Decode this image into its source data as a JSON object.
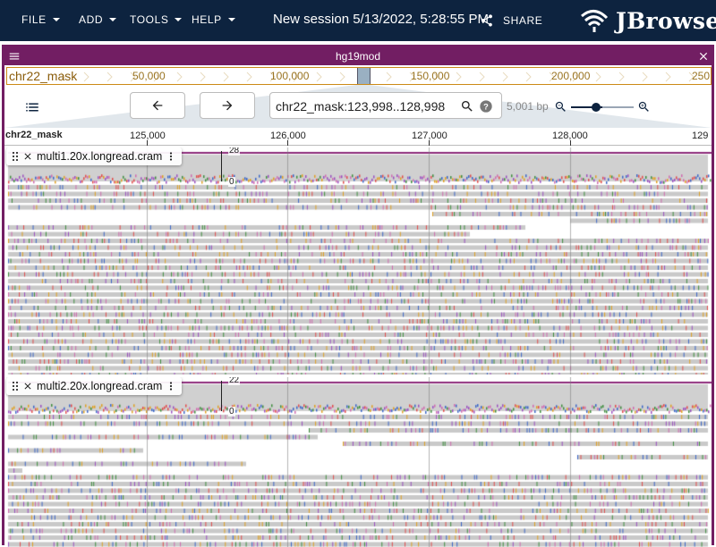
{
  "appbar": {
    "menus": [
      "FILE",
      "ADD",
      "TOOLS",
      "HELP"
    ],
    "session_title": "New session 5/13/2022, 5:28:55 PM",
    "share_label": "SHARE",
    "logo_text": "JBrowse"
  },
  "view": {
    "title": "hg19mod",
    "overview": {
      "ref_name": "chr22_mask",
      "ticks": [
        "50,000",
        "100,000",
        "150,000",
        "200,000",
        "250"
      ]
    },
    "location": "chr22_mask:123,998..128,998",
    "bp_label": "5,001 bp",
    "ruler": {
      "ref_name": "chr22_mask",
      "ticks": [
        "125,000",
        "126,000",
        "127,000",
        "128,000",
        "129"
      ]
    },
    "tracks": [
      {
        "name": "multi1.20x.longread.cram",
        "scale_max": "28",
        "scale_min": "0"
      },
      {
        "name": "multi2.20x.longread.cram",
        "scale_max": "22",
        "scale_min": "0"
      }
    ]
  },
  "colors": {
    "appbar": "#0d233f",
    "view_border": "#721e63",
    "overview_border": "#cc8a16",
    "read_fill": "#c8c8c8",
    "coverage_fill": "#d0d0d0"
  }
}
